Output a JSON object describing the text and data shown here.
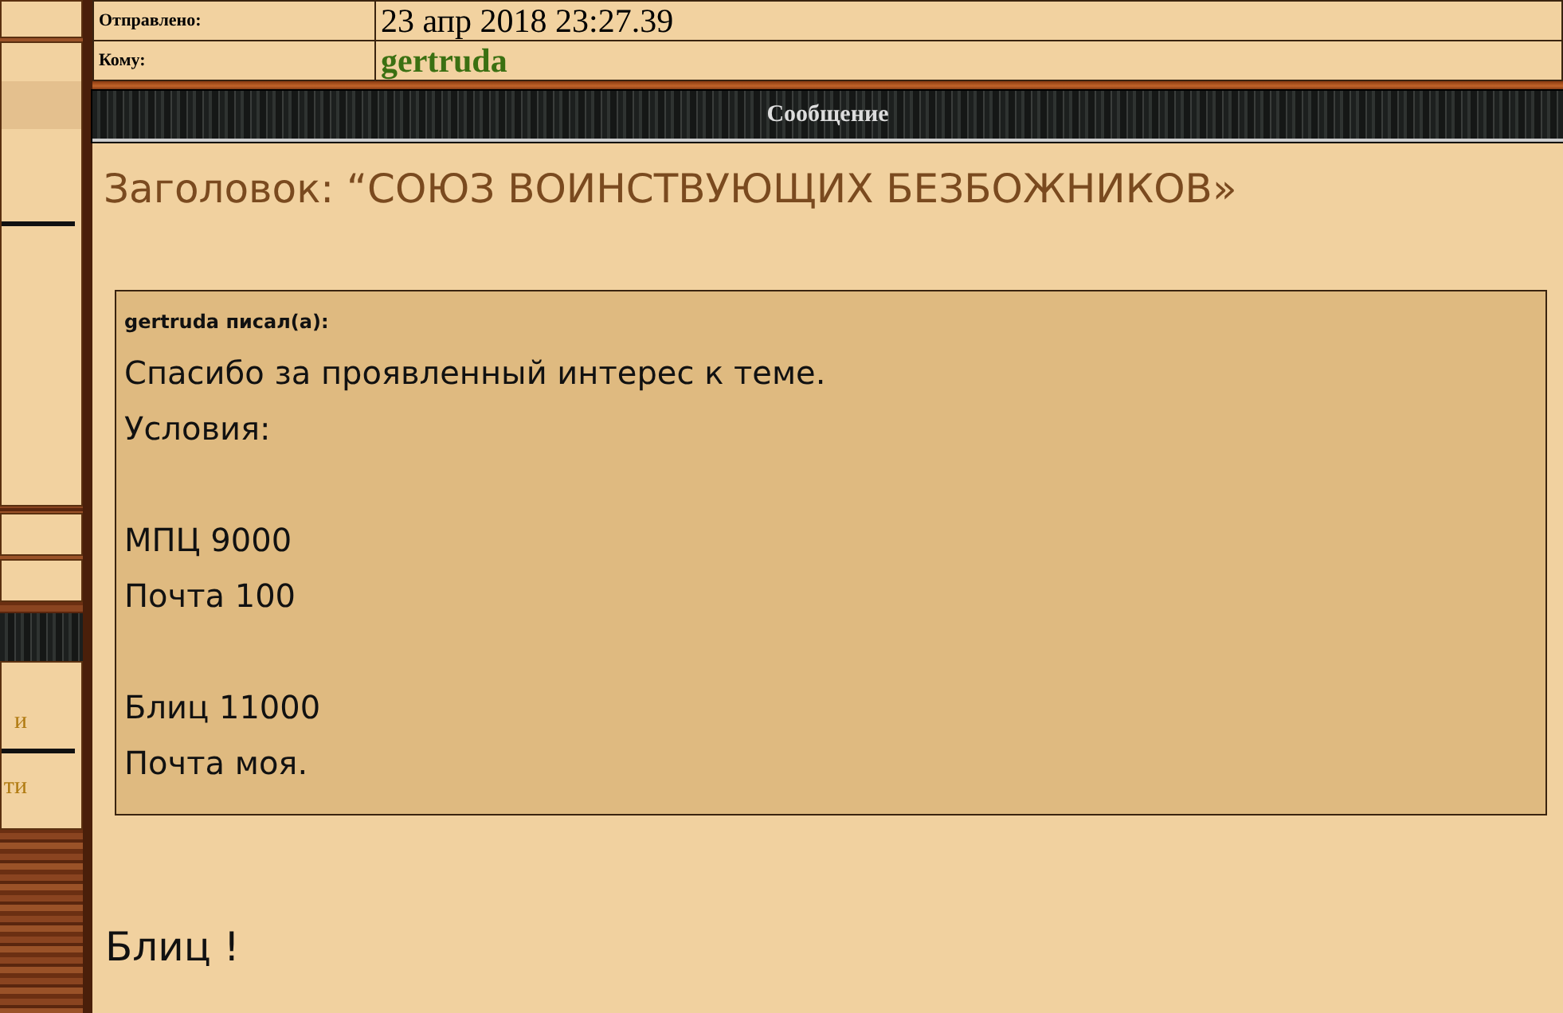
{
  "sidebar": {
    "items": [
      {
        "label": "и"
      },
      {
        "label": "ти"
      }
    ]
  },
  "meta": [
    {
      "label": "Отправлено:",
      "value": "23 апр 2018 23:27.39",
      "kind": "text"
    },
    {
      "label": "Кому:",
      "value": "gertruda",
      "kind": "user"
    }
  ],
  "section_title": "Сообщение",
  "subject": "Заголовок: “СОЮЗ ВОИНСТВУЮЩИХ БЕЗБОЖНИКОВ»",
  "quote": {
    "author": "gertruda писал(а):",
    "paragraphs": [
      [
        "Спасибо за проявленный интерес к теме.",
        "Условия:"
      ],
      [
        "МПЦ 9000",
        "Почта 100"
      ],
      [
        "Блиц 11000",
        "Почта моя."
      ]
    ]
  },
  "reply": "Блиц !"
}
